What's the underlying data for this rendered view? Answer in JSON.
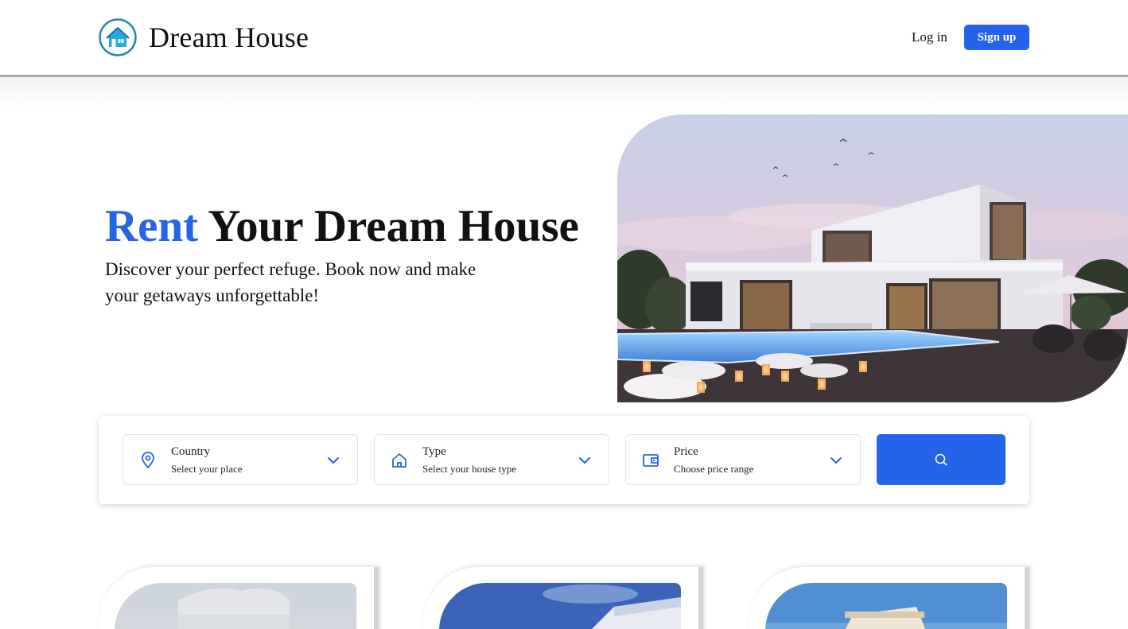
{
  "header": {
    "brand": "Dream House",
    "logo_icon": "house-logo-icon",
    "login_label": "Log in",
    "signup_label": "Sign up"
  },
  "hero": {
    "title_accent": "Rent",
    "title_rest": "Your Dream House",
    "subtitle": "Discover your perfect refuge. Book now and make your getaways unforgettable!"
  },
  "search": {
    "fields": [
      {
        "label": "Country",
        "placeholder": "Select your place",
        "icon": "location-pin-icon"
      },
      {
        "label": "Type",
        "placeholder": "Select your house type",
        "icon": "house-icon"
      },
      {
        "label": "Price",
        "placeholder": "Choose price range",
        "icon": "wallet-icon"
      }
    ],
    "button_icon": "search-icon"
  },
  "colors": {
    "accent": "#2563eb",
    "text": "#111111",
    "border": "#e3e3e3"
  }
}
